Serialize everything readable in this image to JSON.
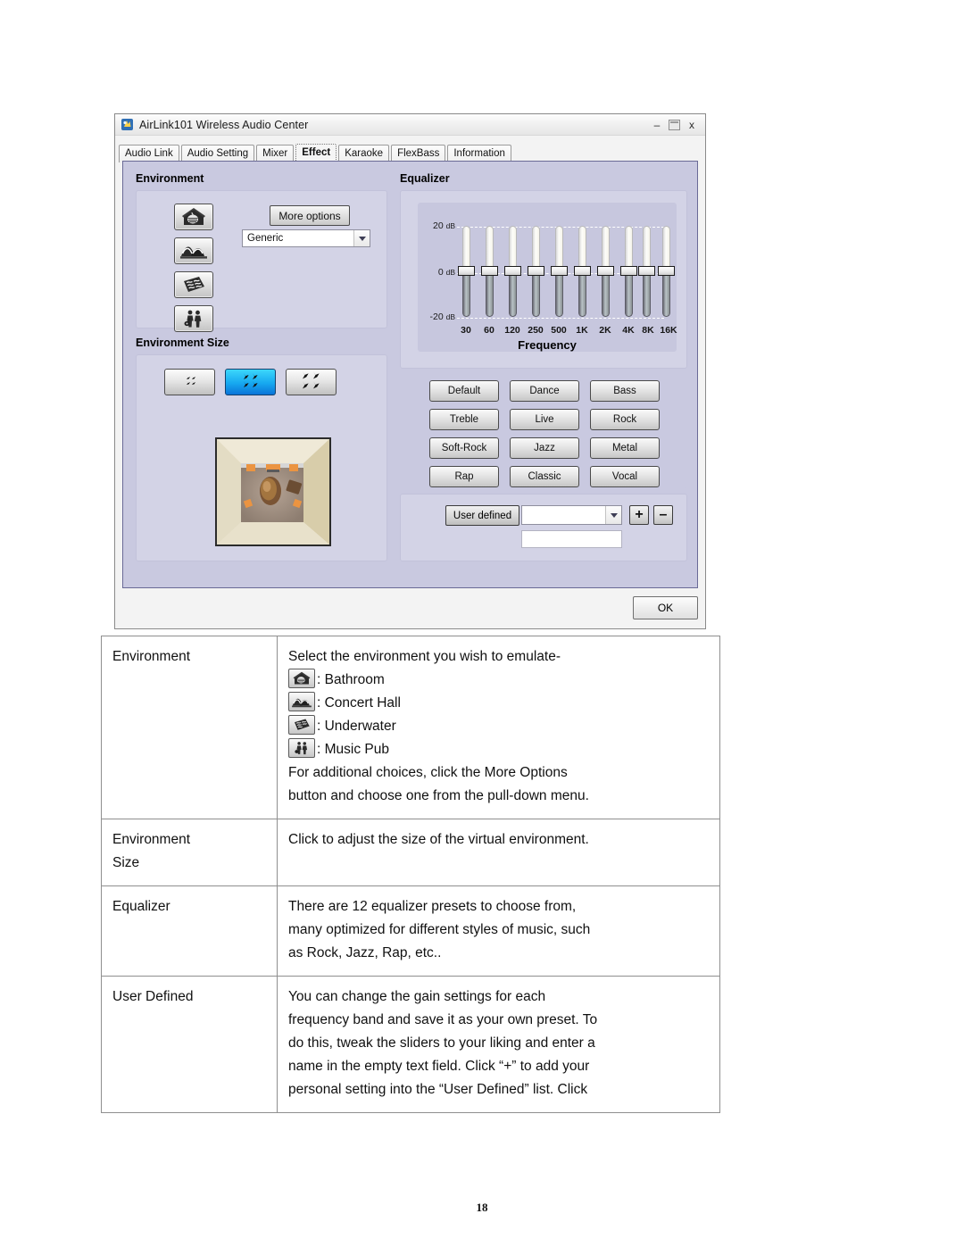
{
  "window": {
    "title": "AirLink101 Wireless Audio Center",
    "icon": "app-icon",
    "buttons": {
      "minimize": "–",
      "maximize": "",
      "close": "x"
    }
  },
  "tabs": [
    {
      "label": "Audio Link",
      "active": false
    },
    {
      "label": "Audio Setting",
      "active": false
    },
    {
      "label": "Mixer",
      "active": false
    },
    {
      "label": "Effect",
      "active": true
    },
    {
      "label": "Karaoke",
      "active": false
    },
    {
      "label": "FlexBass",
      "active": false
    },
    {
      "label": "Information",
      "active": false
    }
  ],
  "environment": {
    "title": "Environment",
    "icon_buttons": [
      {
        "name": "bathroom-icon",
        "label": "Bathroom"
      },
      {
        "name": "concert-hall-icon",
        "label": "Concert Hall"
      },
      {
        "name": "underwater-icon",
        "label": "Underwater"
      },
      {
        "name": "music-pub-icon",
        "label": "Music Pub"
      }
    ],
    "more_options_label": "More options",
    "preset_select_value": "Generic"
  },
  "environment_size": {
    "title": "Environment Size",
    "options": [
      {
        "name": "size-small",
        "selected": false
      },
      {
        "name": "size-medium",
        "selected": true
      },
      {
        "name": "size-large",
        "selected": false
      }
    ]
  },
  "equalizer": {
    "title": "Equalizer",
    "axis_labels": [
      {
        "value": "20",
        "unit": "dB"
      },
      {
        "value": "0",
        "unit": "dB"
      },
      {
        "value": "-20",
        "unit": "dB"
      }
    ],
    "frequency_title": "Frequency",
    "bands": [
      "30",
      "60",
      "120",
      "250",
      "500",
      "1K",
      "2K",
      "4K",
      "8K",
      "16K"
    ],
    "band_values": [
      0,
      0,
      0,
      0,
      0,
      0,
      0,
      0,
      0,
      0
    ],
    "presets": [
      "Default",
      "Dance",
      "Bass",
      "Treble",
      "Live",
      "Rock",
      "Soft-Rock",
      "Jazz",
      "Metal",
      "Rap",
      "Classic",
      "Vocal"
    ],
    "user_defined": {
      "button_label": "User defined",
      "select_value": "",
      "name_field_value": "",
      "add_label": "+",
      "remove_label": "–"
    }
  },
  "dialog": {
    "ok_label": "OK"
  },
  "chart_data": {
    "type": "bar",
    "title": "Equalizer",
    "xlabel": "Frequency",
    "ylabel": "dB",
    "categories": [
      "30",
      "60",
      "120",
      "250",
      "500",
      "1K",
      "2K",
      "4K",
      "8K",
      "16K"
    ],
    "values": [
      0,
      0,
      0,
      0,
      0,
      0,
      0,
      0,
      0,
      0
    ],
    "ylim": [
      -20,
      20
    ],
    "yticks": [
      20,
      0,
      -20
    ],
    "grid": true,
    "legend": "none"
  },
  "description_table": {
    "rows": [
      {
        "term": "Environment",
        "intro": "Select the environment you wish to emulate-",
        "items": [
          {
            "icon": "bathroom-icon",
            "text": ": Bathroom"
          },
          {
            "icon": "concert-hall-icon",
            "text": ": Concert Hall"
          },
          {
            "icon": "underwater-icon",
            "text": ": Underwater"
          },
          {
            "icon": "music-pub-icon",
            "text": ": Music Pub"
          }
        ],
        "outro_line1": "For additional choices, click the More Options",
        "outro_line2": "button and choose one from the pull-down menu."
      },
      {
        "term_line1": "Environment",
        "term_line2": "Size",
        "body": "Click to adjust the size of the virtual environment."
      },
      {
        "term": "Equalizer",
        "body_line1": "There are 12 equalizer presets to choose from,",
        "body_line2": "many optimized for different styles of music, such",
        "body_line3": "as Rock, Jazz, Rap, etc.."
      },
      {
        "term": "User Defined",
        "body_line1": "You can change the gain settings for each",
        "body_line2": "frequency band and save it as your own preset. To",
        "body_line3": "do this, tweak the sliders to your liking and enter a",
        "body_line4": "name in the empty text field. Click “+” to add your",
        "body_line5": "personal setting into the “User Defined” list. Click"
      }
    ]
  },
  "page": {
    "number": "18"
  }
}
